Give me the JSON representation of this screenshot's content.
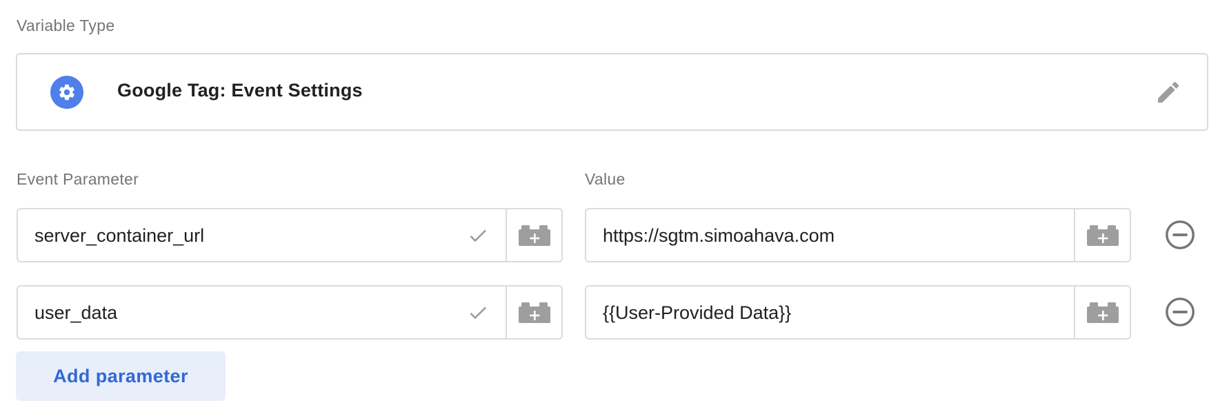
{
  "variable_type": {
    "label": "Variable Type",
    "name": "Google Tag: Event Settings",
    "icon": "gear-icon",
    "icon_color": "#4f80ea",
    "edit_icon": "pencil-icon"
  },
  "table": {
    "param_header": "Event Parameter",
    "value_header": "Value",
    "rows": [
      {
        "parameter": "server_container_url",
        "value": "https://sgtm.simoahava.com"
      },
      {
        "parameter": "user_data",
        "value": "{{User-Provided Data}}"
      }
    ]
  },
  "add_button_label": "Add parameter",
  "colors": {
    "accent": "#3367d6",
    "add_button_bg": "#e8effb",
    "border": "#dadce0",
    "icon_gray": "#9e9e9e"
  }
}
